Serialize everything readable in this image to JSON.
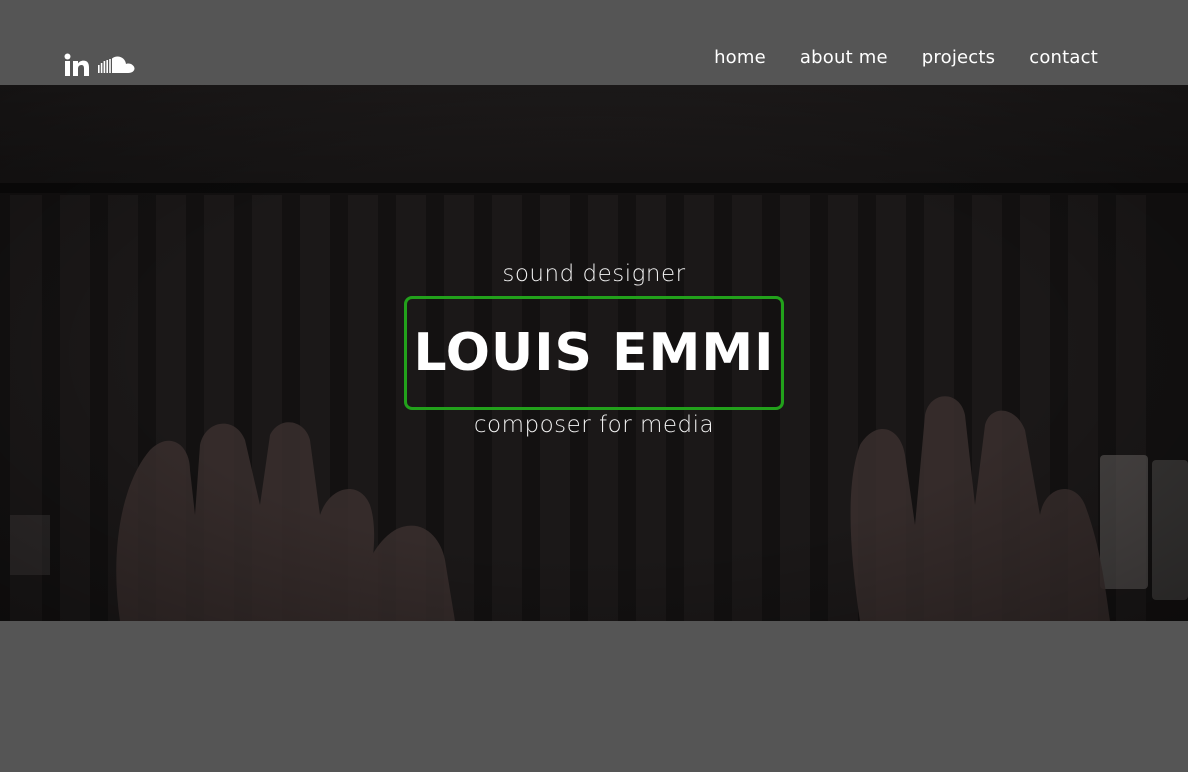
{
  "social": {
    "icons": [
      "linkedin-icon",
      "soundcloud-icon"
    ]
  },
  "nav": {
    "items": [
      {
        "label": "home"
      },
      {
        "label": "about me"
      },
      {
        "label": "projects"
      },
      {
        "label": "contact"
      }
    ]
  },
  "hero": {
    "subtitle_top": "sound designer",
    "name": "LOUIS EMMI",
    "subtitle_bottom": "composer for media",
    "accent_color": "#22a11b",
    "background_description_icon": "piano-hands-image"
  },
  "colors": {
    "page_background": "#555555",
    "hero_overlay": "#141213",
    "text": "#ffffff"
  }
}
